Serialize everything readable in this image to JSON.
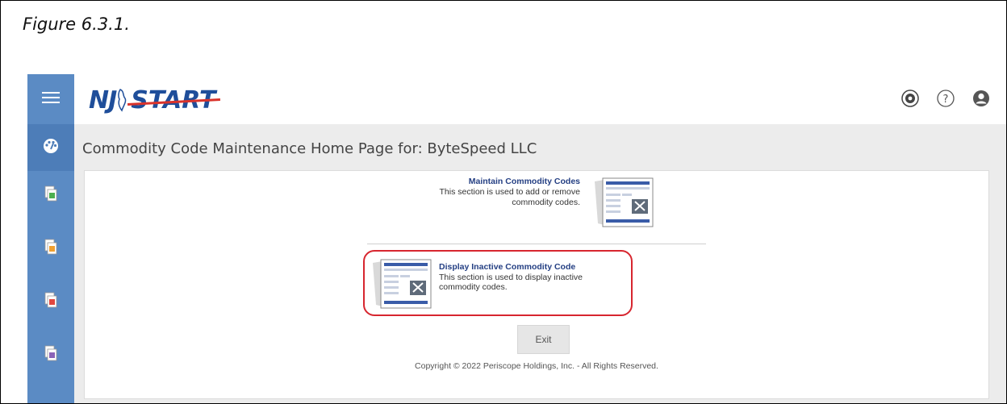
{
  "figure": {
    "caption": "Figure 6.3.1."
  },
  "header": {
    "logo_prefix": "NJ",
    "logo_word": "START",
    "icons": [
      "settings-icon",
      "help-icon",
      "user-icon"
    ]
  },
  "sidebar": {
    "items": [
      {
        "icon": "menu-icon"
      },
      {
        "icon": "dashboard-icon"
      },
      {
        "icon": "document-green-icon"
      },
      {
        "icon": "document-orange-icon"
      },
      {
        "icon": "document-red-icon"
      },
      {
        "icon": "document-purple-icon"
      }
    ],
    "color": "#5b8bc4"
  },
  "page": {
    "title": "Commodity Code Maintenance Home Page for: ByteSpeed LLC"
  },
  "sections": {
    "maintain": {
      "title": "Maintain Commodity Codes",
      "line1": "This section is used to add or remove",
      "line2": "commodity codes."
    },
    "display_inactive": {
      "title": "Display Inactive Commodity Code",
      "line1": "This section is used to display inactive",
      "line2": "commodity codes."
    }
  },
  "buttons": {
    "exit": "Exit"
  },
  "footer": {
    "copyright": "Copyright © 2022 Periscope Holdings, Inc. - All Rights Reserved."
  },
  "colors": {
    "accent": "#243f83",
    "highlight": "#d7262f",
    "sidebar": "#5b8bc4"
  }
}
